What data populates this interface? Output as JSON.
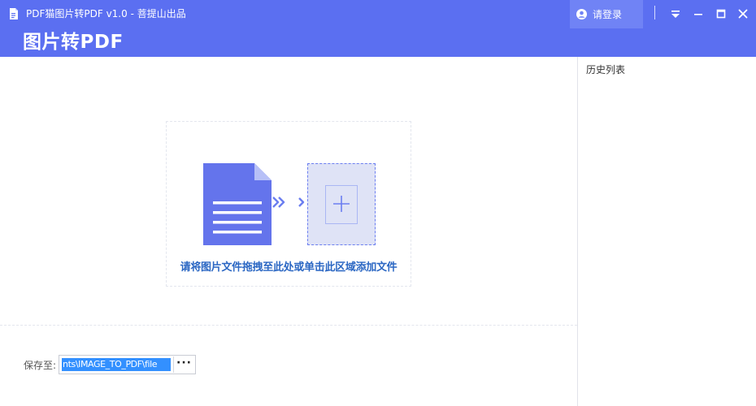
{
  "window": {
    "title": "PDF猫图片转PDF v1.0 - 菩提山出品",
    "heading": "图片转PDF",
    "icon": "pdf-doc-icon"
  },
  "titlebar": {
    "login_label": "请登录",
    "login_icon": "user-icon",
    "menu_icon": "menu-icon",
    "minimize_icon": "minimize-icon",
    "maximize_icon": "maximize-icon",
    "close_icon": "close-icon"
  },
  "dropzone": {
    "hint": "请将图片文件拖拽至此处或单击此区域添加文件",
    "doc_icon": "document-icon",
    "arrow_icon": "double-chevron-right-icon",
    "add_icon": "plus-icon"
  },
  "save": {
    "label": "保存至:",
    "path": "nts\\IMAGE_TO_PDF\\file",
    "browse_label": "···"
  },
  "history": {
    "title": "历史列表"
  },
  "colors": {
    "brand": "#5b6ff1",
    "login_bg": "#7083f5",
    "hint_text": "#2b67c3",
    "selection": "#3390ff"
  }
}
